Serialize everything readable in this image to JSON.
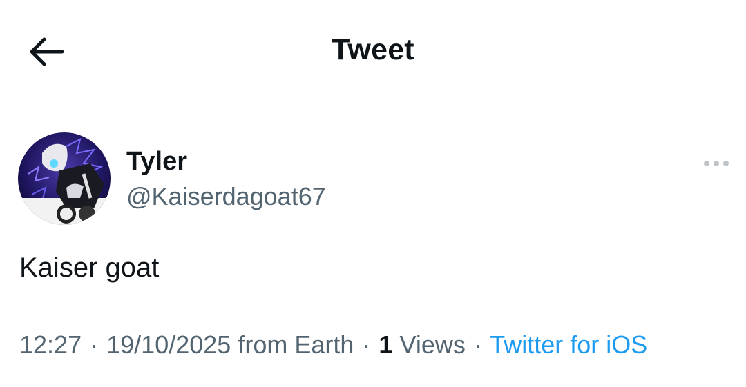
{
  "header": {
    "title": "Tweet",
    "back_icon": "arrow-left-icon"
  },
  "author": {
    "display_name": "Tyler",
    "handle": "@Kaiserdagoat67",
    "avatar": "profile-picture"
  },
  "more_icon": "more-horizontal-icon",
  "tweet": {
    "text": "Kaiser goat",
    "time": "12:27",
    "date": "19/10/2025",
    "location": "from Earth",
    "separator": "·",
    "views_count": "1",
    "views_label": "Views",
    "source": "Twitter for iOS"
  },
  "colors": {
    "text_primary": "#0f1419",
    "text_secondary": "#536471",
    "link": "#1d9bf0"
  }
}
